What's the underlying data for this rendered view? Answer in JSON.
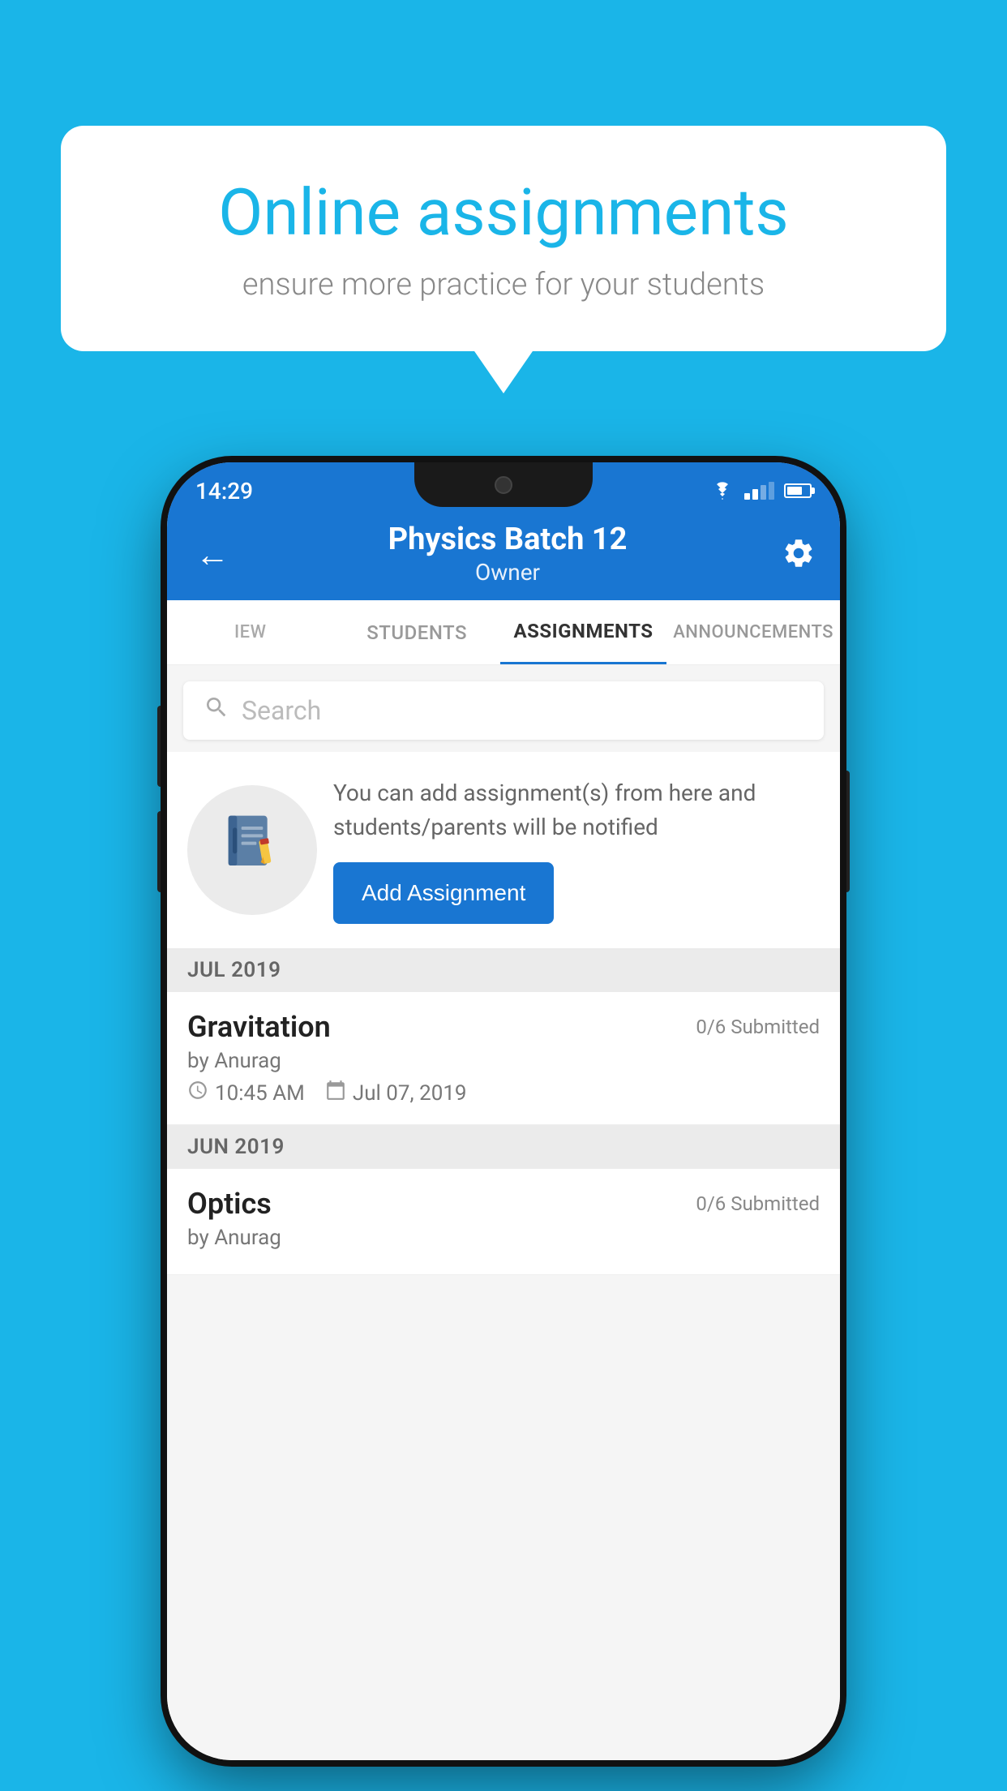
{
  "background_color": "#1ab5e8",
  "speech_bubble": {
    "title": "Online assignments",
    "subtitle": "ensure more practice for your students"
  },
  "phone": {
    "status_bar": {
      "time": "14:29"
    },
    "header": {
      "title": "Physics Batch 12",
      "subtitle": "Owner"
    },
    "tabs": [
      {
        "label": "IEW",
        "active": false
      },
      {
        "label": "STUDENTS",
        "active": false
      },
      {
        "label": "ASSIGNMENTS",
        "active": true
      },
      {
        "label": "ANNOUNCEMENTS",
        "active": false
      }
    ],
    "search": {
      "placeholder": "Search"
    },
    "add_assignment_section": {
      "description": "You can add assignment(s) from here and students/parents will be notified",
      "button_label": "Add Assignment"
    },
    "sections": [
      {
        "month": "JUL 2019",
        "assignments": [
          {
            "name": "Gravitation",
            "submitted": "0/6 Submitted",
            "author": "by Anurag",
            "time": "10:45 AM",
            "date": "Jul 07, 2019"
          }
        ]
      },
      {
        "month": "JUN 2019",
        "assignments": [
          {
            "name": "Optics",
            "submitted": "0/6 Submitted",
            "author": "by Anurag",
            "time": "",
            "date": ""
          }
        ]
      }
    ]
  }
}
